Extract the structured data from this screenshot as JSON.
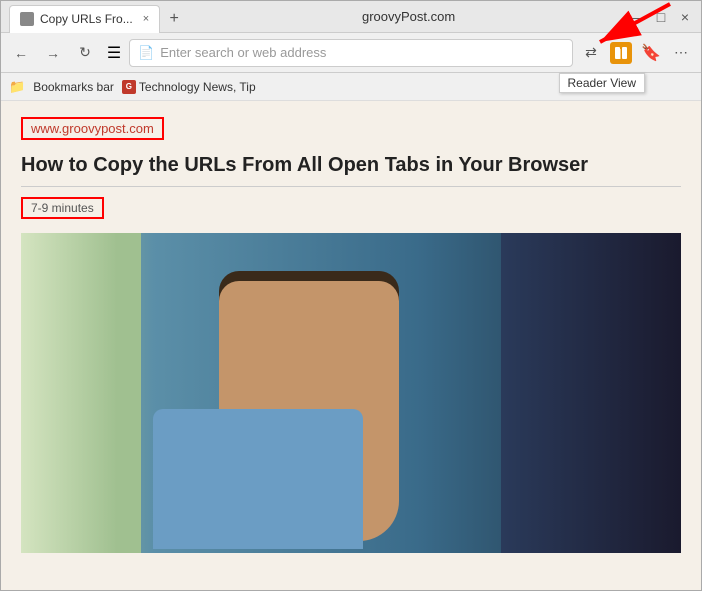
{
  "browser": {
    "title": "groovyPost.com",
    "tab": {
      "title": "Copy URLs Fro...",
      "close_label": "×"
    },
    "new_tab_label": "+",
    "window_controls": {
      "minimize": "—",
      "maximize": "□",
      "close_btn": "×"
    }
  },
  "toolbar": {
    "address_placeholder": "Enter search or web address",
    "reader_view_label": "📖",
    "reader_view_tooltip": "Reader View",
    "back_icon": "←",
    "forward_icon": "→",
    "refresh_icon": "↻",
    "home_icon": "⊙",
    "sidebar_icon": "▤",
    "sync_icon": "⇄",
    "pocket_icon": "📥",
    "menu_icon": "⋯"
  },
  "bookmarks_bar": {
    "label": "Bookmarks bar",
    "items": [
      {
        "label": "Technology News, Tip",
        "favicon": "G"
      }
    ]
  },
  "page": {
    "url": "www.groovypost.com",
    "article_title": "How to Copy the URLs From All Open Tabs in Your Browser",
    "read_time": "7-9 minutes"
  }
}
